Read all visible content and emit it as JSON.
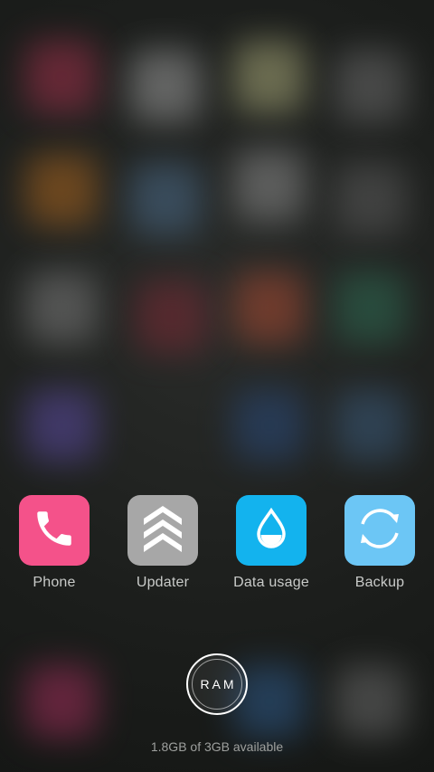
{
  "background": {
    "description_colors": [
      "#a0304a",
      "#9a9a9a",
      "#a8a878",
      "#6a6a6a",
      "#a8641e",
      "#4a6a88",
      "#8a8a8a",
      "#5a5a5a",
      "#7a7a7a",
      "#7a2a34",
      "#a84a32",
      "#2e6a52",
      "#5a4aa0",
      "#2a4a7a",
      "#3a5a7a",
      "#a02e5a",
      "#2e5a8a",
      "#6a6a6a"
    ]
  },
  "dock": {
    "apps": [
      {
        "label": "Phone",
        "icon": "phone-icon",
        "color": "#f4528a"
      },
      {
        "label": "Updater",
        "icon": "updater-chevrons-icon",
        "color": "#a7a7a7"
      },
      {
        "label": "Data usage",
        "icon": "water-drop-icon",
        "color": "#13b3ee"
      },
      {
        "label": "Backup",
        "icon": "sync-circle-icon",
        "color": "#6cc6f5"
      }
    ]
  },
  "ram": {
    "button_label": "RAM",
    "status": "1.8GB of 3GB available"
  }
}
